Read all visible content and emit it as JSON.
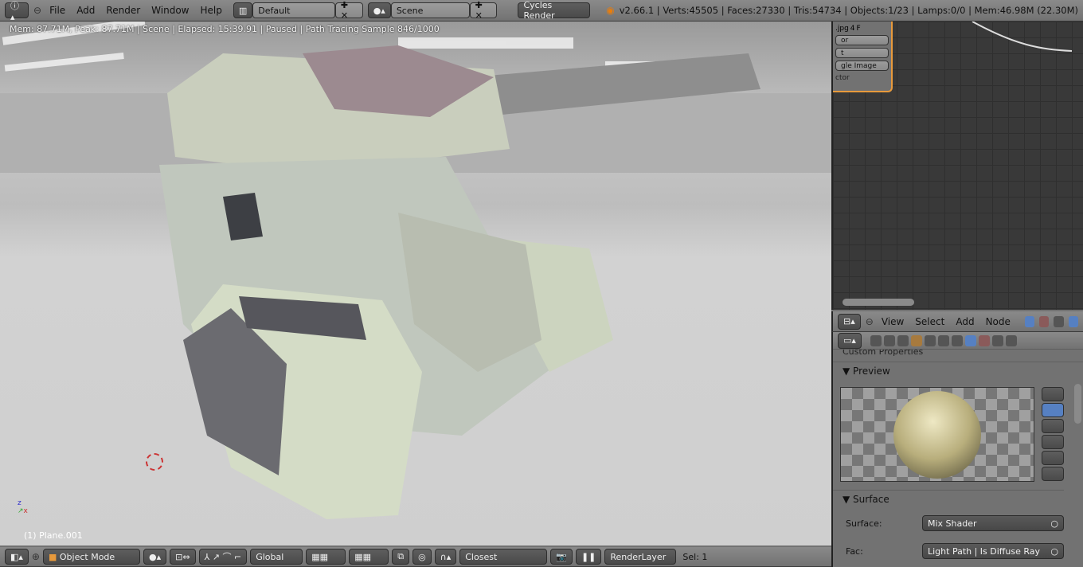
{
  "topbar": {
    "menus": [
      "File",
      "Add",
      "Render",
      "Window",
      "Help"
    ],
    "layout": "Default",
    "scene": "Scene",
    "engine": "Cycles Render",
    "stats": "v2.66.1 | Verts:45505 | Faces:27330 | Tris:54734 | Objects:1/23 | Lamps:0/0 | Mem:46.98M (22.30M)"
  },
  "viewport": {
    "status": "Mem: 87.71M, Peak: 87.71M | Scene | Elapsed: 15:39.91 | Paused | Path Tracing Sample 846/1000",
    "object_name": "(1) Plane.001"
  },
  "node_editor": {
    "node": {
      "header": ".jpg",
      "users": "4",
      "fake": "F",
      "fields": [
        "or",
        "t",
        "gle Image"
      ],
      "socket": "ctor"
    },
    "menus": [
      "View",
      "Select",
      "Add",
      "Node"
    ]
  },
  "properties": {
    "custom_props": "Custom Properties",
    "preview": "Preview",
    "surface_panel": "Surface",
    "surface_label": "Surface:",
    "surface_value": "Mix Shader",
    "fac_label": "Fac:",
    "fac_value": "Light Path | Is Diffuse Ray"
  },
  "bottombar": {
    "mode": "Object Mode",
    "orientation": "Global",
    "snap": "Closest",
    "render_layer": "RenderLayer",
    "sel": "Sel: 1"
  }
}
